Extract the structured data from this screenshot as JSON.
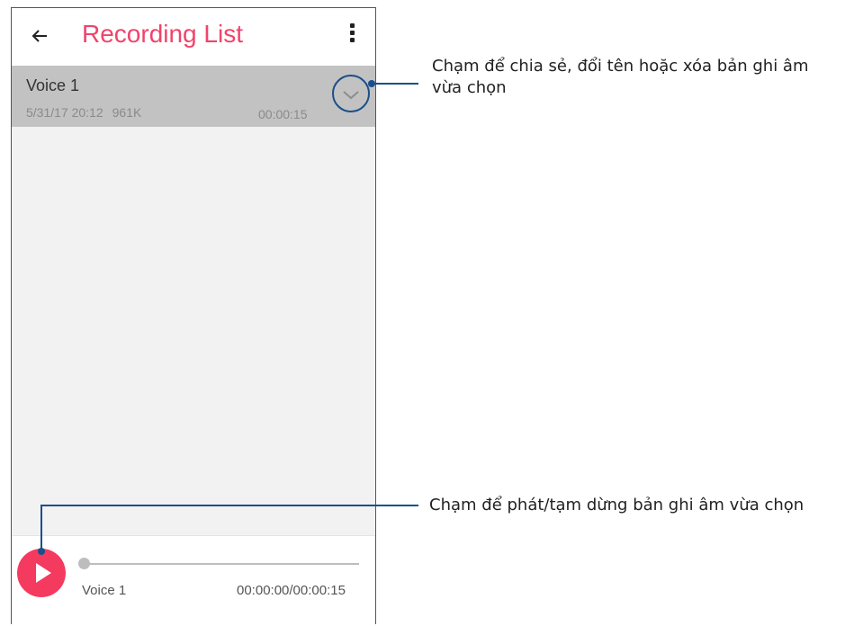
{
  "app": {
    "title": "Recording List"
  },
  "toolbar": {
    "back_icon": "back-arrow-icon",
    "menu_icon": "more-vert-icon"
  },
  "recordings": [
    {
      "name": "Voice 1",
      "date": "5/31/17 20:12",
      "size": "961K",
      "duration": "00:00:15"
    }
  ],
  "player": {
    "track": "Voice 1",
    "time": "00:00:00/00:00:15",
    "progress": 0
  },
  "callouts": {
    "expand": "Chạm để chia sẻ, đổi tên hoặc xóa bản ghi âm vừa chọn",
    "play": "Chạm để phát/tạm dừng bản ghi âm vừa chọn"
  },
  "colors": {
    "accent": "#f0436b",
    "play_button": "#f43a5f",
    "callout_line": "#1a4f8b",
    "selected_row": "#c2c2c2"
  }
}
